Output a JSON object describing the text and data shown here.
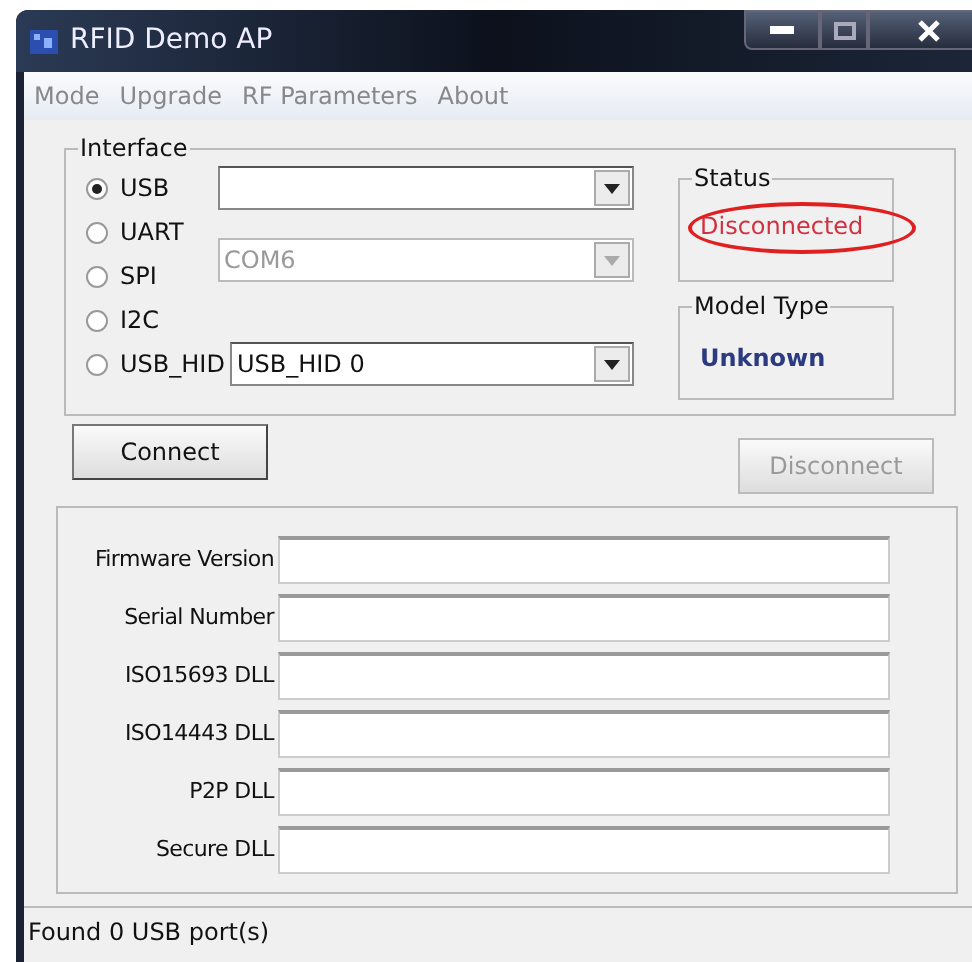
{
  "window": {
    "title": "RFID Demo AP"
  },
  "menu": [
    "Mode",
    "Upgrade",
    "RF Parameters",
    "About"
  ],
  "interface": {
    "title": "Interface",
    "options": [
      {
        "label": "USB",
        "selected": true,
        "combo": {
          "disabled": false
        }
      },
      {
        "label": "UART",
        "selected": false,
        "combo": {
          "value": "COM6",
          "disabled": true
        }
      },
      {
        "label": "SPI",
        "selected": false
      },
      {
        "label": "I2C",
        "selected": false
      },
      {
        "label": "USB_HID",
        "selected": false,
        "combo": {
          "value": "USB_HID 0",
          "disabled": false
        }
      }
    ]
  },
  "status": {
    "title": "Status",
    "value": "Disconnected",
    "highlighted": true
  },
  "model_type": {
    "title": "Model Type",
    "value": "Unknown"
  },
  "buttons": [
    {
      "label": "Connect",
      "disabled": false
    },
    {
      "label": "Disconnect",
      "disabled": true
    }
  ],
  "info_fields": [
    {
      "label": "Firmware Version"
    },
    {
      "label": "Serial Number"
    },
    {
      "label": "ISO15693 DLL"
    },
    {
      "label": "ISO14443 DLL"
    },
    {
      "label": "P2P DLL"
    },
    {
      "label": "Secure DLL"
    }
  ],
  "status_bar": "Found 0 USB port(s)"
}
